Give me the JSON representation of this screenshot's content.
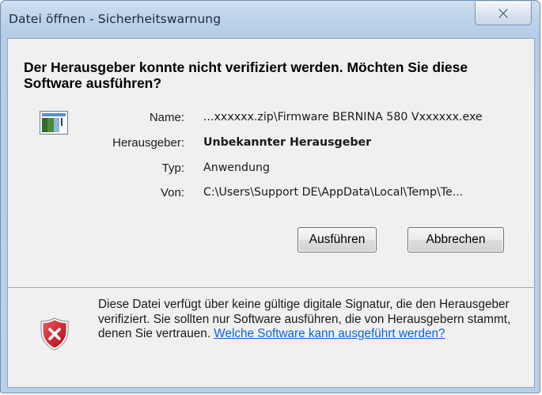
{
  "window": {
    "title": "Datei öffnen - Sicherheitswarnung"
  },
  "dialog": {
    "heading": "Der Herausgeber konnte nicht verifiziert werden. Möchten Sie diese Software ausführen?",
    "fields": [
      {
        "label": "Name:",
        "value": "...xxxxxx.zip\\Firmware BERNINA 580 Vxxxxxx.exe"
      },
      {
        "label": "Herausgeber:",
        "value": "Unbekannter Herausgeber"
      },
      {
        "label": "Typ:",
        "value": "Anwendung"
      },
      {
        "label": "Von:",
        "value": "C:\\Users\\Support DE\\AppData\\Local\\Temp\\Te..."
      }
    ],
    "buttons": {
      "run": "Ausführen",
      "cancel": "Abbrechen"
    },
    "warning": {
      "text": "Diese Datei verfügt über keine gültige digitale Signatur, die den Herausgeber verifiziert. Sie sollten nur Software ausführen, die von Herausgebern stammt, denen Sie vertrauen.",
      "link": "Welche Software kann ausgeführt werden?"
    }
  },
  "icons": {
    "close": "close-icon",
    "file": "application-file-icon",
    "warning": "security-shield-error-icon"
  },
  "colors": {
    "link": "#0b63d6",
    "shield_red": "#c8181e"
  }
}
